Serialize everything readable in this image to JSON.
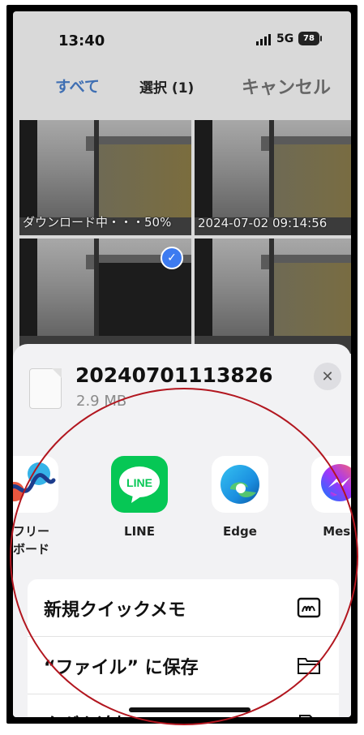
{
  "status_bar": {
    "time": "13:40",
    "network": "5G",
    "battery": "78"
  },
  "toolbar": {
    "select_all": "すべて",
    "selected": "選択 (1)",
    "cancel": "キャンセル"
  },
  "thumbnails": [
    {
      "caption": "ダウンロード中・・・50%",
      "selected": false
    },
    {
      "caption": "2024-07-02 09:14:56",
      "selected": false
    },
    {
      "caption": "",
      "selected": true
    },
    {
      "caption": "",
      "selected": false
    }
  ],
  "file": {
    "name": "20240701113826",
    "size": "2.9 MB"
  },
  "apps": [
    {
      "label": "フリー\nボード",
      "icon": "freeform-icon"
    },
    {
      "label": "LINE",
      "icon": "line-icon",
      "icon_text": "LINE"
    },
    {
      "label": "Edge",
      "icon": "edge-icon"
    },
    {
      "label": "Messen\nr",
      "icon": "messenger-icon"
    }
  ],
  "actions": [
    {
      "label": "新規クイックメモ",
      "icon": "quick-note-icon"
    },
    {
      "label": "“ファイル” に保存",
      "icon": "folder-icon"
    },
    {
      "label": "タグを追加",
      "icon": "tag-icon"
    }
  ],
  "colors": {
    "accent": "#3f6fb3",
    "line_green": "#06c755",
    "annotation_red": "#b2161f"
  }
}
